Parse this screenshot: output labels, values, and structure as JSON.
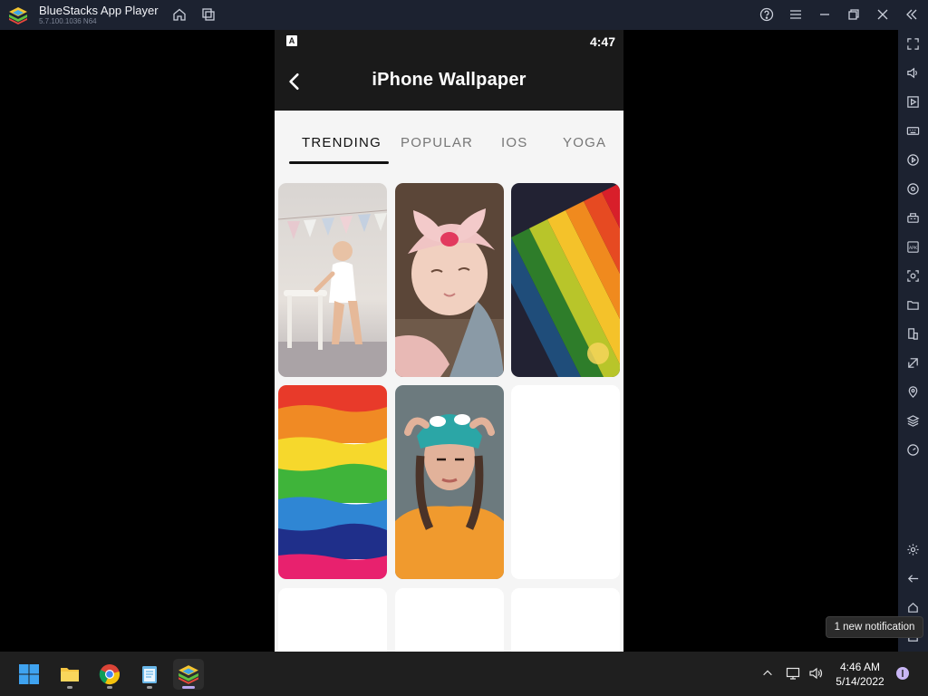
{
  "window": {
    "title": "BlueStacks App Player",
    "version": "5.7.100.1036 N64"
  },
  "app": {
    "status_time": "4:47",
    "status_notification": "A",
    "title": "iPhone Wallpaper",
    "tabs": [
      {
        "label": "TRENDING",
        "active": true
      },
      {
        "label": "POPULAR",
        "active": false
      },
      {
        "label": "IOS",
        "active": false
      },
      {
        "label": "YOGA",
        "active": false
      }
    ],
    "wallpapers": [
      {
        "subject": "baby standing by white stool"
      },
      {
        "subject": "baby in pink headband"
      },
      {
        "subject": "colored pencils"
      },
      {
        "subject": "rainbow paint stripes"
      },
      {
        "subject": "woman in teal beanie"
      },
      {
        "subject": "loading placeholder"
      },
      {
        "subject": "loading placeholder"
      },
      {
        "subject": "loading placeholder"
      },
      {
        "subject": "loading placeholder"
      }
    ]
  },
  "taskbar": {
    "time": "4:46 AM",
    "date": "5/14/2022"
  },
  "notification_toast": "1 new notification",
  "colors": {
    "titlebar": "#1c2230",
    "app_header": "#1a1a1a",
    "tab_active": "#111111",
    "tab_inactive": "#777777",
    "taskbar": "#1f1f1f",
    "accent": "#b9a7f0"
  }
}
